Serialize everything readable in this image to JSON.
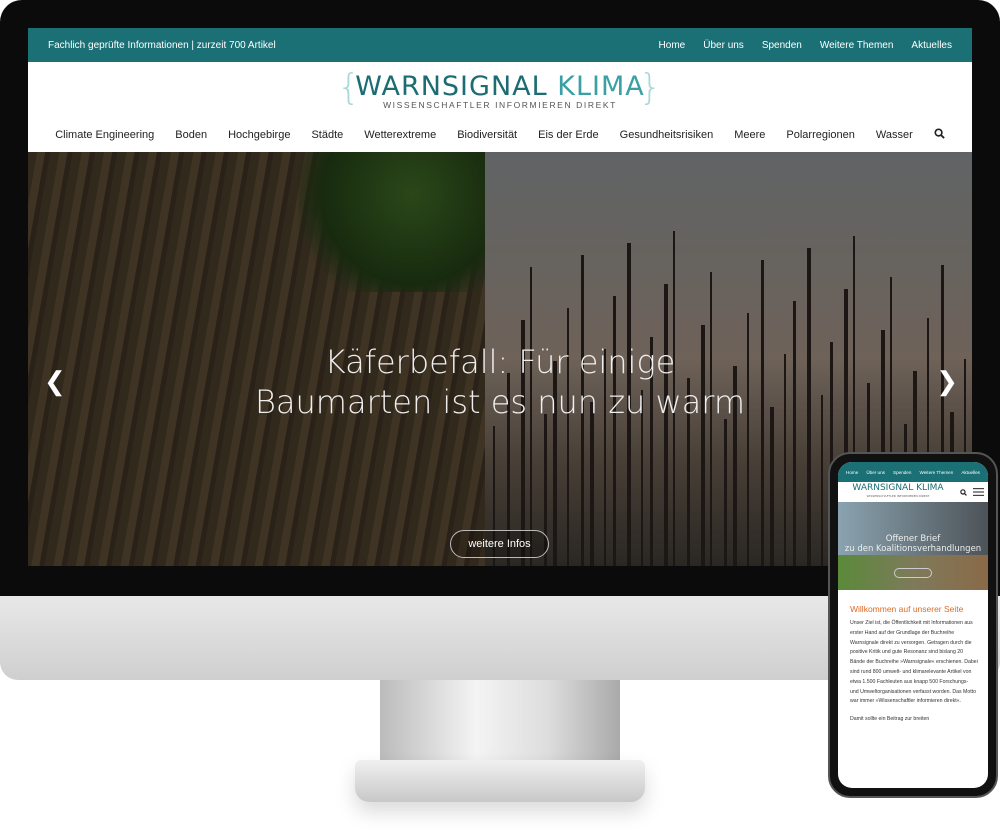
{
  "desktop": {
    "topbar": {
      "tagline": "Fachlich geprüfte Informationen | zurzeit 700 Artikel",
      "links": [
        "Home",
        "Über uns",
        "Spenden",
        "Weitere Themen",
        "Aktuelles"
      ]
    },
    "logo": {
      "title_a": "WARNSIGNAL",
      "title_b": "KLIMA",
      "subtitle": "WISSENSCHAFTLER INFORMIEREN DIREKT"
    },
    "nav": [
      "Climate Engineering",
      "Boden",
      "Hochgebirge",
      "Städte",
      "Wetterextreme",
      "Biodiversität",
      "Eis der Erde",
      "Gesundheitsrisiken",
      "Meere",
      "Polarregionen",
      "Wasser"
    ],
    "hero": {
      "title_line1": "Käferbefall: Für einige",
      "title_line2": "Baumarten ist es nun zu warm",
      "button": "weitere Infos"
    }
  },
  "mobile": {
    "topbar": {
      "links": [
        "Home",
        "Über uns",
        "Spenden",
        "Weitere Themen",
        "Aktuelles"
      ]
    },
    "logo": {
      "title": "WARNSIGNAL KLIMA",
      "subtitle": "WISSENSCHAFTLER INFORMIEREN DIREKT"
    },
    "hero": {
      "line1": "Offener Brief",
      "line2": "zu den Koalitionsverhandlungen"
    },
    "welcome": {
      "heading": "Willkommen auf unserer Seite",
      "para1": "Unser Ziel ist, die Öffentlichkeit mit Informationen aus erster Hand auf der Grundlage der Buchreihe Warnsignale direkt zu versorgen. Getragen durch die positive Kritik und gute Resonanz sind bislang 20 Bände der Buchreihe »Warnsignale« erschienen. Dabei sind rund 800 umwelt- und klimarelevante Artikel von etwa 1.500 Fachleuten aus knapp 500 Forschungs- und Umweltorganisationen verfasst worden. Das Motto war immer »Wissenschaftler informieren direkt«.",
      "para2": "Damit sollte ein Beitrag zur breiten"
    }
  },
  "colors": {
    "brand": "#1b7075",
    "accent": "#e06a25"
  }
}
